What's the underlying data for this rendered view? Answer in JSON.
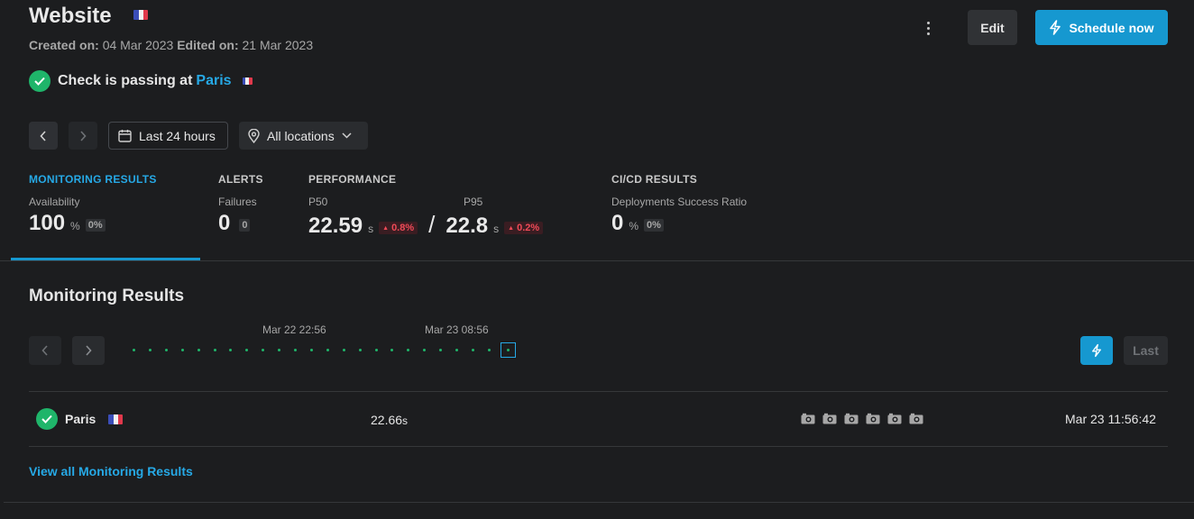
{
  "header": {
    "title": "Website",
    "created_label": "Created on:",
    "created_value": "04 Mar 2023",
    "edited_label": "Edited on:",
    "edited_value": "21 Mar 2023",
    "status_prefix": "Check is passing at",
    "status_location": "Paris",
    "edit_label": "Edit",
    "schedule_label": "Schedule now",
    "icons": [
      "france-flag-icon",
      "check-icon",
      "kebab-menu-icon",
      "bolt-icon"
    ]
  },
  "filters": {
    "range_label": "Last 24 hours",
    "location_label": "All locations",
    "icons": [
      "chevron-left-icon",
      "chevron-right-icon",
      "calendar-icon",
      "pin-icon",
      "chevron-down-icon"
    ]
  },
  "tabs": {
    "monitoring": {
      "label": "MONITORING RESULTS",
      "sub": "Availability",
      "value": "100",
      "unit": "%",
      "pill": "0%"
    },
    "alerts": {
      "label": "ALERTS",
      "sub": "Failures",
      "value": "0",
      "pill": "0"
    },
    "performance": {
      "label": "PERFORMANCE",
      "p50_label": "P50",
      "p50_value": "22.59",
      "p50_unit": "s",
      "p50_delta": "0.8%",
      "separator": "/",
      "p95_label": "P95",
      "p95_value": "22.8",
      "p95_unit": "s",
      "p95_delta": "0.2%"
    },
    "cicd": {
      "label": "CI/CD RESULTS",
      "sub": "Deployments Success Ratio",
      "value": "0",
      "unit": "%",
      "pill": "0%"
    }
  },
  "results": {
    "title": "Monitoring Results",
    "timeline_label_1": "Mar 22 22:56",
    "timeline_label_2": "Mar 23 08:56",
    "timeline_dots": 24,
    "last_label": "Last",
    "row": {
      "location": "Paris",
      "duration": "22.66",
      "duration_unit": "s",
      "screenshots": 6,
      "date": "Mar 23 11:56:42"
    },
    "view_all": "View all Monitoring Results"
  },
  "colors": {
    "background": "#1c1d1f",
    "accent": "#1698d0",
    "link": "#26a9e6",
    "success": "#1fb56a",
    "danger": "#ef4a57"
  }
}
